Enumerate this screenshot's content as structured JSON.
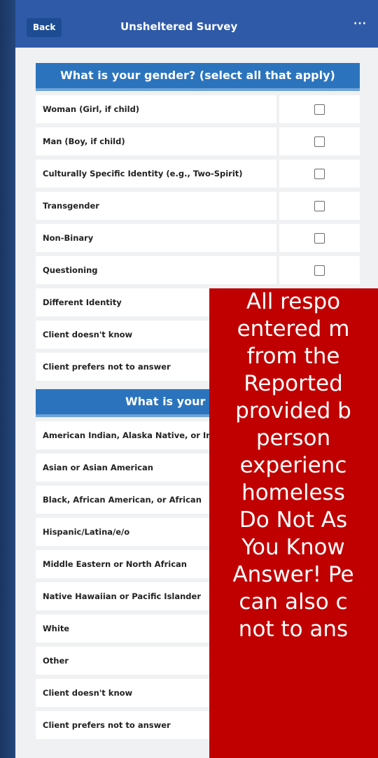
{
  "nav": {
    "back": "Back",
    "title": "Unsheltered Survey",
    "more": "···"
  },
  "gender": {
    "header": "What is your gender? (select all that apply)",
    "options": [
      "Woman (Girl, if child)",
      "Man (Boy, if child)",
      "Culturally Specific Identity (e.g., Two-Spirit)",
      "Transgender",
      "Non-Binary",
      "Questioning",
      "Different Identity",
      "Client doesn't know",
      "Client prefers not to answer"
    ]
  },
  "race": {
    "header": "What is your race? (sel",
    "options": [
      "American Indian, Alaska Native, or In",
      "Asian or Asian American",
      "Black, African American, or African",
      "Hispanic/Latina/e/o",
      "Middle Eastern or North African",
      "Native Hawaiian or Pacific Islander",
      "White",
      "Other",
      "Client doesn't know",
      "Client prefers not to answer"
    ]
  },
  "overlay": {
    "lines": [
      "All respo",
      "entered m",
      "from the",
      "Reported",
      "provided b",
      "person",
      "experienc",
      "homeless",
      "Do Not As",
      "You Know",
      "Answer! Pe",
      "can also c",
      "not to ans"
    ]
  }
}
